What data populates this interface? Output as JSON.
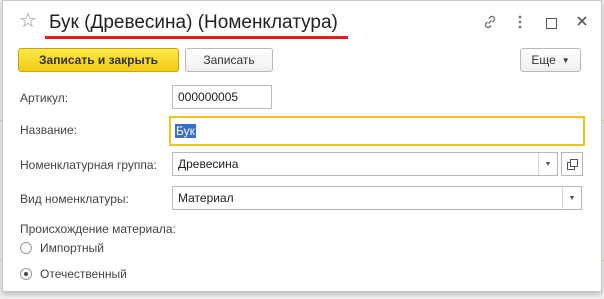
{
  "window": {
    "title": "Бук (Древесина) (Номенклатура)"
  },
  "icons": {
    "favorite": "star-icon",
    "link": "link-icon",
    "more": "more-vertical-icon",
    "maximize": "maximize-icon",
    "close": "close-icon"
  },
  "toolbar": {
    "save_close_label": "Записать и закрыть",
    "save_label": "Записать",
    "more_label": "Еще"
  },
  "form": {
    "article_label": "Артикул:",
    "article_value": "000000005",
    "name_label": "Название:",
    "name_value": "Бук",
    "group_label": "Номенклатурная группа:",
    "group_value": "Древесина",
    "kind_label": "Вид номенклатуры:",
    "kind_value": "Материал",
    "origin_label": "Происхождение материала:",
    "origin_options": [
      {
        "label": "Импортный",
        "selected": false
      },
      {
        "label": "Отечественный",
        "selected": true
      }
    ]
  },
  "colors": {
    "primary_button": "#f2cb14",
    "focus_border": "#f5c21b",
    "title_underline": "#e02020",
    "selection": "#3a6fc9"
  }
}
